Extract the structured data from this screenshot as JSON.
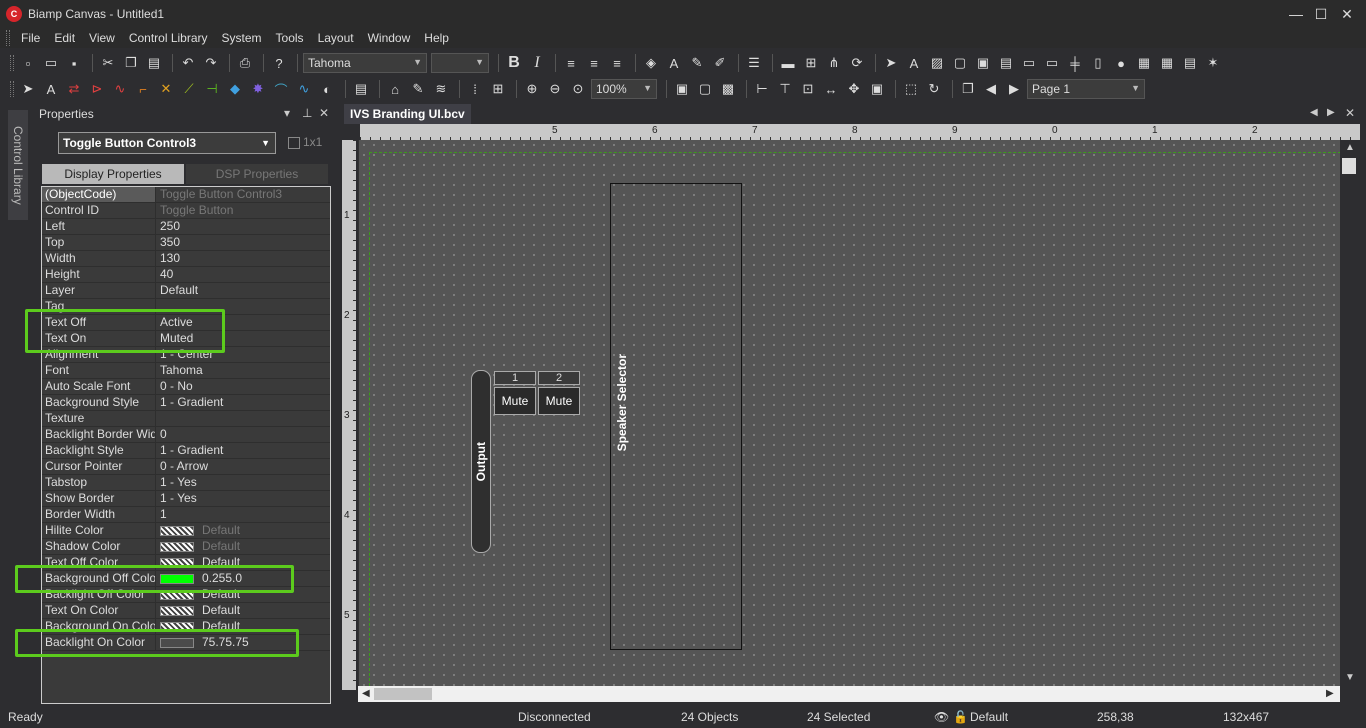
{
  "window": {
    "title": "Biamp Canvas - Untitled1",
    "icon": "C",
    "minimize": "—",
    "maximize": "☐",
    "close": "✕"
  },
  "menu": [
    "File",
    "Edit",
    "View",
    "Control Library",
    "System",
    "Tools",
    "Layout",
    "Window",
    "Help"
  ],
  "toolbar1": {
    "font_name": "Tahoma",
    "font_size": "",
    "bold": "B",
    "italic": "I"
  },
  "toolbar2": {
    "zoom": "100%",
    "page": "Page 1"
  },
  "side_tab": "Control Library",
  "properties": {
    "title": "Properties",
    "selected_object": "Toggle Button Control3",
    "grid_size_label": "1x1",
    "tabs": [
      "Display Properties",
      "DSP Properties"
    ],
    "rows": [
      {
        "name": "(ObjectCode)",
        "value": "Toggle Button Control3",
        "dim": true
      },
      {
        "name": "Control ID",
        "value": "Toggle Button",
        "dim": true
      },
      {
        "name": "Left",
        "value": "250"
      },
      {
        "name": "Top",
        "value": "350"
      },
      {
        "name": "Width",
        "value": "130"
      },
      {
        "name": "Height",
        "value": "40"
      },
      {
        "name": "Layer",
        "value": "Default"
      },
      {
        "name": "Tag",
        "value": ""
      },
      {
        "name": "Text Off",
        "value": "Active"
      },
      {
        "name": "Text On",
        "value": "Muted"
      },
      {
        "name": "Alignment",
        "value": "1 - Center"
      },
      {
        "name": "Font",
        "value": "Tahoma"
      },
      {
        "name": "Auto Scale Font",
        "value": "0 - No"
      },
      {
        "name": "Background Style",
        "value": "1 - Gradient"
      },
      {
        "name": "Texture",
        "value": ""
      },
      {
        "name": "Backlight Border Width",
        "value": "0"
      },
      {
        "name": "Backlight Style",
        "value": "1 - Gradient"
      },
      {
        "name": "Cursor Pointer",
        "value": "0 - Arrow"
      },
      {
        "name": "Tabstop",
        "value": "1 - Yes"
      },
      {
        "name": "Show Border",
        "value": "1 - Yes"
      },
      {
        "name": "Border Width",
        "value": "1"
      },
      {
        "name": "Hilite Color",
        "value": "Default",
        "swatch": "pattern",
        "dim": true
      },
      {
        "name": "Shadow Color",
        "value": "Default",
        "swatch": "pattern",
        "dim": true
      },
      {
        "name": "Text Off Color",
        "value": "Default",
        "swatch": "pattern"
      },
      {
        "name": "Background Off Color",
        "value": "0.255.0",
        "swatch": "#00ff00"
      },
      {
        "name": "Backlight Off Color",
        "value": "Default",
        "swatch": "pattern"
      },
      {
        "name": "Text On Color",
        "value": "Default",
        "swatch": "pattern"
      },
      {
        "name": "Background On Color",
        "value": "Default",
        "swatch": "pattern"
      },
      {
        "name": "Backlight On Color",
        "value": "75.75.75",
        "swatch": "#4b4b4b"
      }
    ]
  },
  "document": {
    "tab": "IVS Branding UI.bcv",
    "ruler_top": [
      "5",
      "6",
      "7",
      "8",
      "9",
      "0",
      "1",
      "2"
    ],
    "ruler_left": [
      "1",
      "2",
      "3",
      "4",
      "5"
    ],
    "controls": {
      "output_label": "Output",
      "channels": [
        "1",
        "2"
      ],
      "mute_label": "Mute",
      "speaker_selector": "Speaker Selector"
    }
  },
  "status": {
    "ready": "Ready",
    "connection": "Disconnected",
    "objects": "24 Objects",
    "selected": "24 Selected",
    "layer": "Default",
    "coords": "258,38",
    "size": "132x467"
  },
  "colors": {
    "highlight": "#5ccb1d",
    "accent_red": "#d6252b"
  }
}
